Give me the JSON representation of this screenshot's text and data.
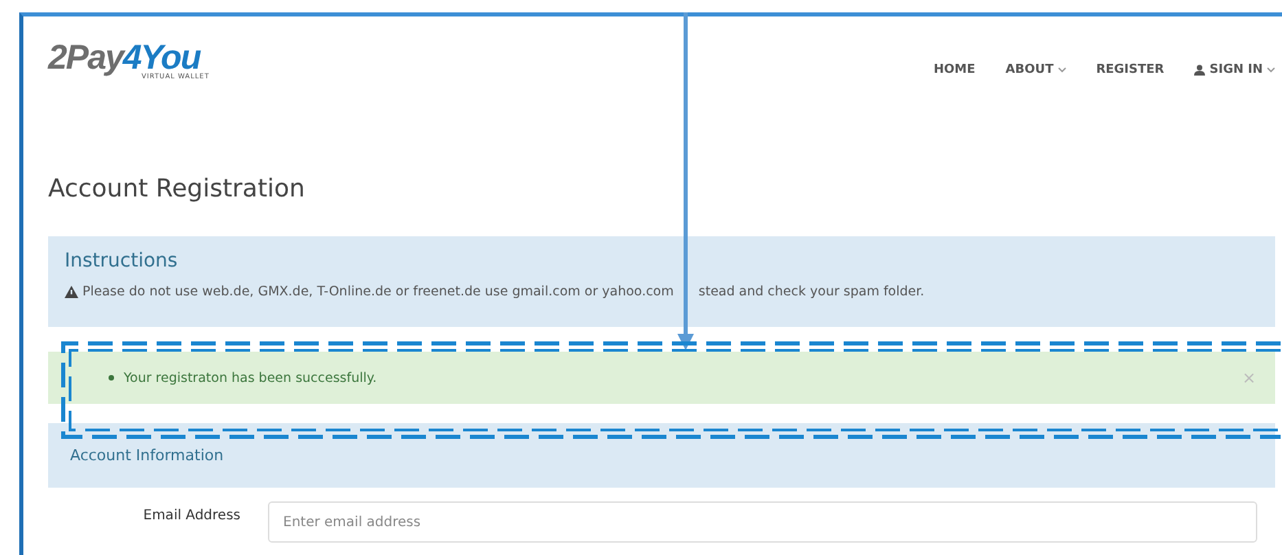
{
  "logo": {
    "name": "2Pay",
    "accent": "4You",
    "tagline": "VIRTUAL WALLET"
  },
  "nav": [
    {
      "label": "HOME",
      "kind": "link"
    },
    {
      "label": "ABOUT",
      "kind": "menu"
    },
    {
      "label": "REGISTER",
      "kind": "link"
    },
    {
      "label": "SIGN IN",
      "kind": "account"
    }
  ],
  "page_title": "Account Registration",
  "instructions": {
    "title": "Instructions",
    "text": "Please do not use web.de, GMX.de, T-Online.de or freenet.de use gmail.com or yahoo.com",
    "text_after_arrow": "stead and check your spam folder."
  },
  "alert": {
    "kind": "success",
    "message": "Your registraton has been successfully.",
    "close": "×"
  },
  "section": {
    "title": "Account Information",
    "fields": [
      {
        "label": "Email Address",
        "placeholder": "Enter email address"
      }
    ]
  },
  "annotations": [
    {
      "kind": "arrow"
    },
    {
      "kind": "dashed-frame"
    }
  ]
}
